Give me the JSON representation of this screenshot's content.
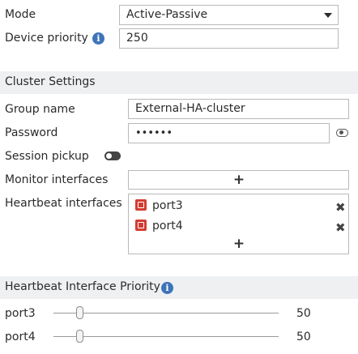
{
  "mode": {
    "label": "Mode",
    "value": "Active-Passive"
  },
  "device_priority": {
    "label": "Device priority",
    "value": "250"
  },
  "cluster_settings": {
    "header": "Cluster Settings",
    "group_name": {
      "label": "Group name",
      "value": "External-HA-cluster"
    },
    "password": {
      "label": "Password",
      "value": "••••••"
    },
    "session_pickup": {
      "label": "Session pickup",
      "enabled": false
    },
    "monitor_interfaces": {
      "label": "Monitor interfaces",
      "add": "+"
    },
    "heartbeat_interfaces": {
      "label": "Heartbeat interfaces",
      "items": [
        {
          "name": "port3",
          "remove": "✖"
        },
        {
          "name": "port4",
          "remove": "✖"
        }
      ],
      "add": "+"
    }
  },
  "heartbeat_priority": {
    "header": "Heartbeat Interface Priority",
    "rows": [
      {
        "port": "port3",
        "value": "50"
      },
      {
        "port": "port4",
        "value": "50"
      }
    ]
  },
  "icons": {
    "info": "info-icon",
    "eye": "eye-icon",
    "port": "port-icon",
    "remove": "close-icon",
    "toggle": "toggle-icon",
    "caret": "chevron-down-icon"
  },
  "colors": {
    "info": "#3e74b8",
    "port_icon": "#d53b31",
    "section_bg": "#eef0f2"
  }
}
